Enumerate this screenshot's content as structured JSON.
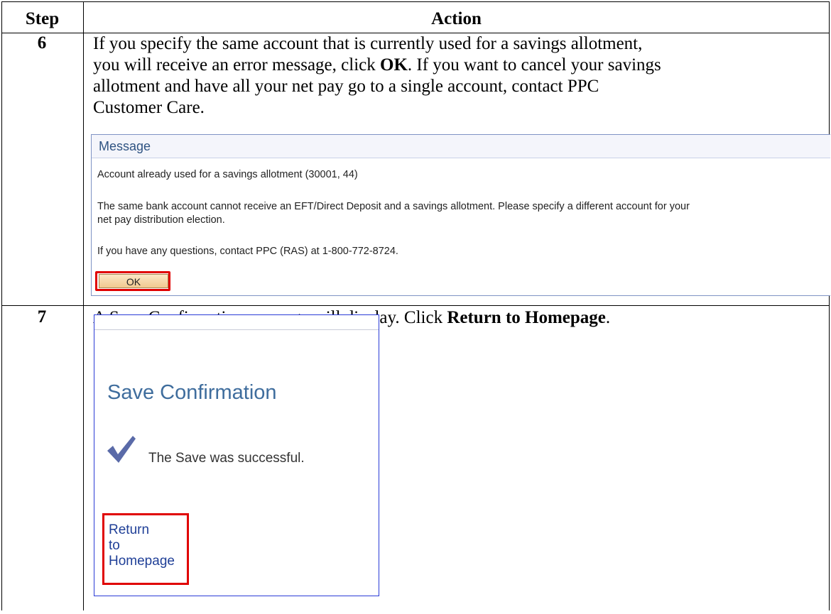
{
  "table": {
    "headers": {
      "step": "Step",
      "action": "Action"
    },
    "rows": [
      {
        "step": "6",
        "action_lines": [
          "If you specify the same account that is currently used for a savings allotment,",
          "you will receive an error message, click ",
          "OK",
          ".  If you want to cancel your savings",
          "allotment and have all your net pay go to a single account, contact PPC",
          "Customer Care."
        ]
      },
      {
        "step": "7",
        "action_prefix": "A Save Confirmation message will display.  Click ",
        "action_bold": "Return to Homepage",
        "action_suffix": "."
      }
    ]
  },
  "message_panel": {
    "title": "Message",
    "line1": "Account already used for a savings allotment (30001, 44)",
    "line2a": "The same bank account cannot receive an EFT/Direct Deposit and a savings allotment.  Please specify a different account for your",
    "line2b": "net pay distribution election.",
    "line3": "If you have any questions, contact PPC (RAS) at 1-800-772-8724.",
    "ok_label": "OK"
  },
  "save_panel": {
    "title": "Save Confirmation",
    "check_icon": "checkmark-icon",
    "message": "The Save was successful.",
    "link_line1": "Return",
    "link_line2": "to",
    "link_line3": "Homepage"
  },
  "colors": {
    "highlight": "#e00000",
    "link": "#1f3f97",
    "panel_title": "#3f6d9d",
    "check": "#5a6aa8"
  }
}
